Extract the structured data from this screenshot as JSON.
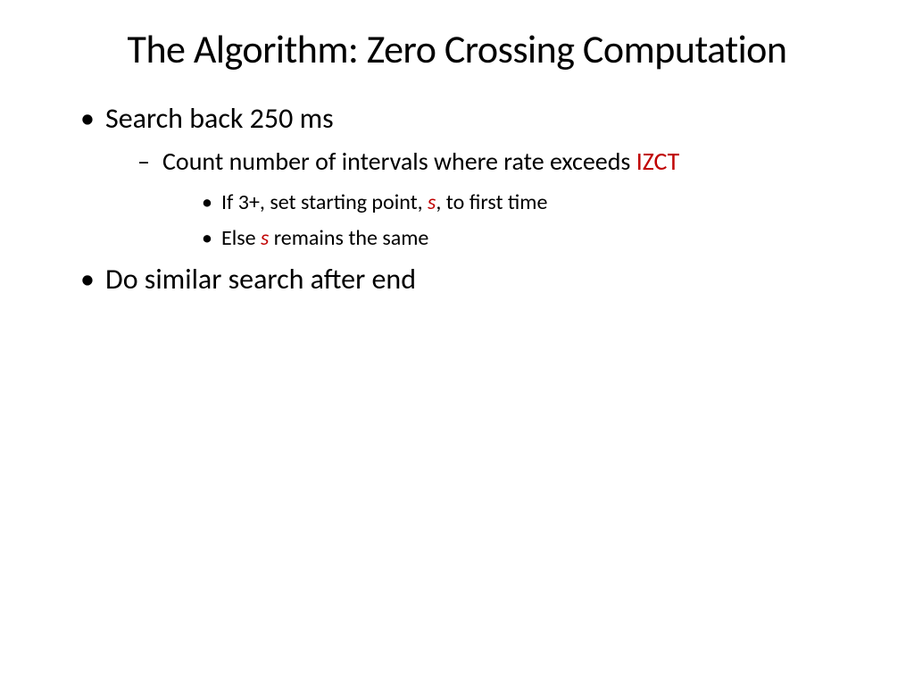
{
  "title": "The Algorithm: Zero Crossing Computation",
  "bullets": {
    "b1": "Search back 250 ms",
    "b1_1_pre": "Count number of intervals where rate exceeds ",
    "b1_1_accent": "IZCT",
    "b1_1_1_pre": "If 3+, set starting point, ",
    "b1_1_1_s": "s",
    "b1_1_1_post": ", to first time",
    "b1_1_2_pre": "Else ",
    "b1_1_2_s": "s",
    "b1_1_2_post": " remains the same",
    "b2": "Do similar search after end"
  }
}
